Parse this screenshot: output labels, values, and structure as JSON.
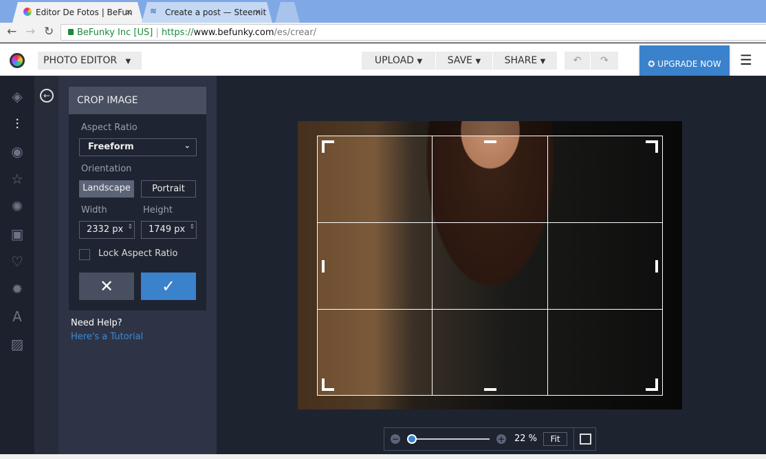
{
  "browser": {
    "tabs": [
      {
        "title": "Editor De Fotos  |  BeFun",
        "icon": "befunky-icon"
      },
      {
        "title": "Create a post — Steemit",
        "icon": "steemit-icon"
      }
    ],
    "security_label": "BeFunky Inc [US]",
    "url_scheme": "https://",
    "url_host": "www.befunky.com",
    "url_path": "/es/crear/"
  },
  "header": {
    "app_menu": "PHOTO EDITOR",
    "upload": "UPLOAD",
    "save": "SAVE",
    "share": "SHARE",
    "upgrade": "UPGRADE NOW"
  },
  "sidebar": {
    "icons": [
      "layers-icon",
      "sliders-icon",
      "eye-icon",
      "star-icon",
      "badge-icon",
      "frame-icon",
      "heart-icon",
      "shape-icon",
      "text-icon",
      "texture-icon"
    ]
  },
  "crop": {
    "title": "CROP IMAGE",
    "aspect_label": "Aspect Ratio",
    "aspect_value": "Freeform",
    "orientation_label": "Orientation",
    "landscape": "Landscape",
    "portrait": "Portrait",
    "width_label": "Width",
    "height_label": "Height",
    "width_value": "2332 px",
    "height_value": "1749 px",
    "lock_label": "Lock Aspect Ratio",
    "lock_checked": false
  },
  "help": {
    "title": "Need Help?",
    "link": "Here's a Tutorial"
  },
  "zoom": {
    "percent": "22 %",
    "fit": "Fit",
    "slider_fraction": 0.0
  },
  "colors": {
    "accent": "#3b82cc",
    "tab_bar": "#7fa9e6",
    "panel": "#2e3445"
  }
}
